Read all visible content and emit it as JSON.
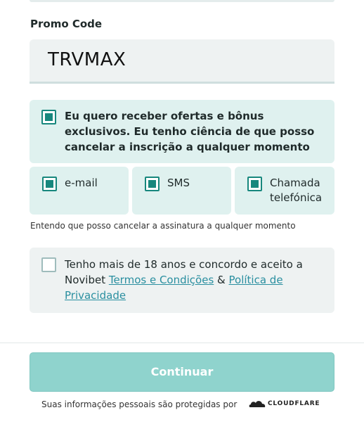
{
  "promo": {
    "label": "Promo Code",
    "value": "TRVMAX"
  },
  "offers": {
    "checked": true,
    "text": "Eu quero receber ofertas e bônus exclusivos. Eu tenho ciência de que posso cancelar a inscrição a qualquer momento"
  },
  "channels": [
    {
      "label": "e-mail",
      "checked": true
    },
    {
      "label": "SMS",
      "checked": true
    },
    {
      "label": "Chamada telefónica",
      "checked": true
    }
  ],
  "cancel_note": "Entendo que posso cancelar a assinatura a qualquer momento",
  "terms": {
    "checked": false,
    "prefix": "Tenho mais de 18 anos e concordo e aceito a Novibet ",
    "terms_link": "Termos e Condições",
    "amp": " & ",
    "privacy_link": "Política de Privacidade"
  },
  "continue_label": "Continuar",
  "footer": {
    "text": "Suas informações pessoais são protegidas por",
    "brand": "CLOUDFLARE"
  },
  "colors": {
    "accent": "#17877d",
    "button": "#8fd3cd",
    "link": "#2a8fa0"
  }
}
